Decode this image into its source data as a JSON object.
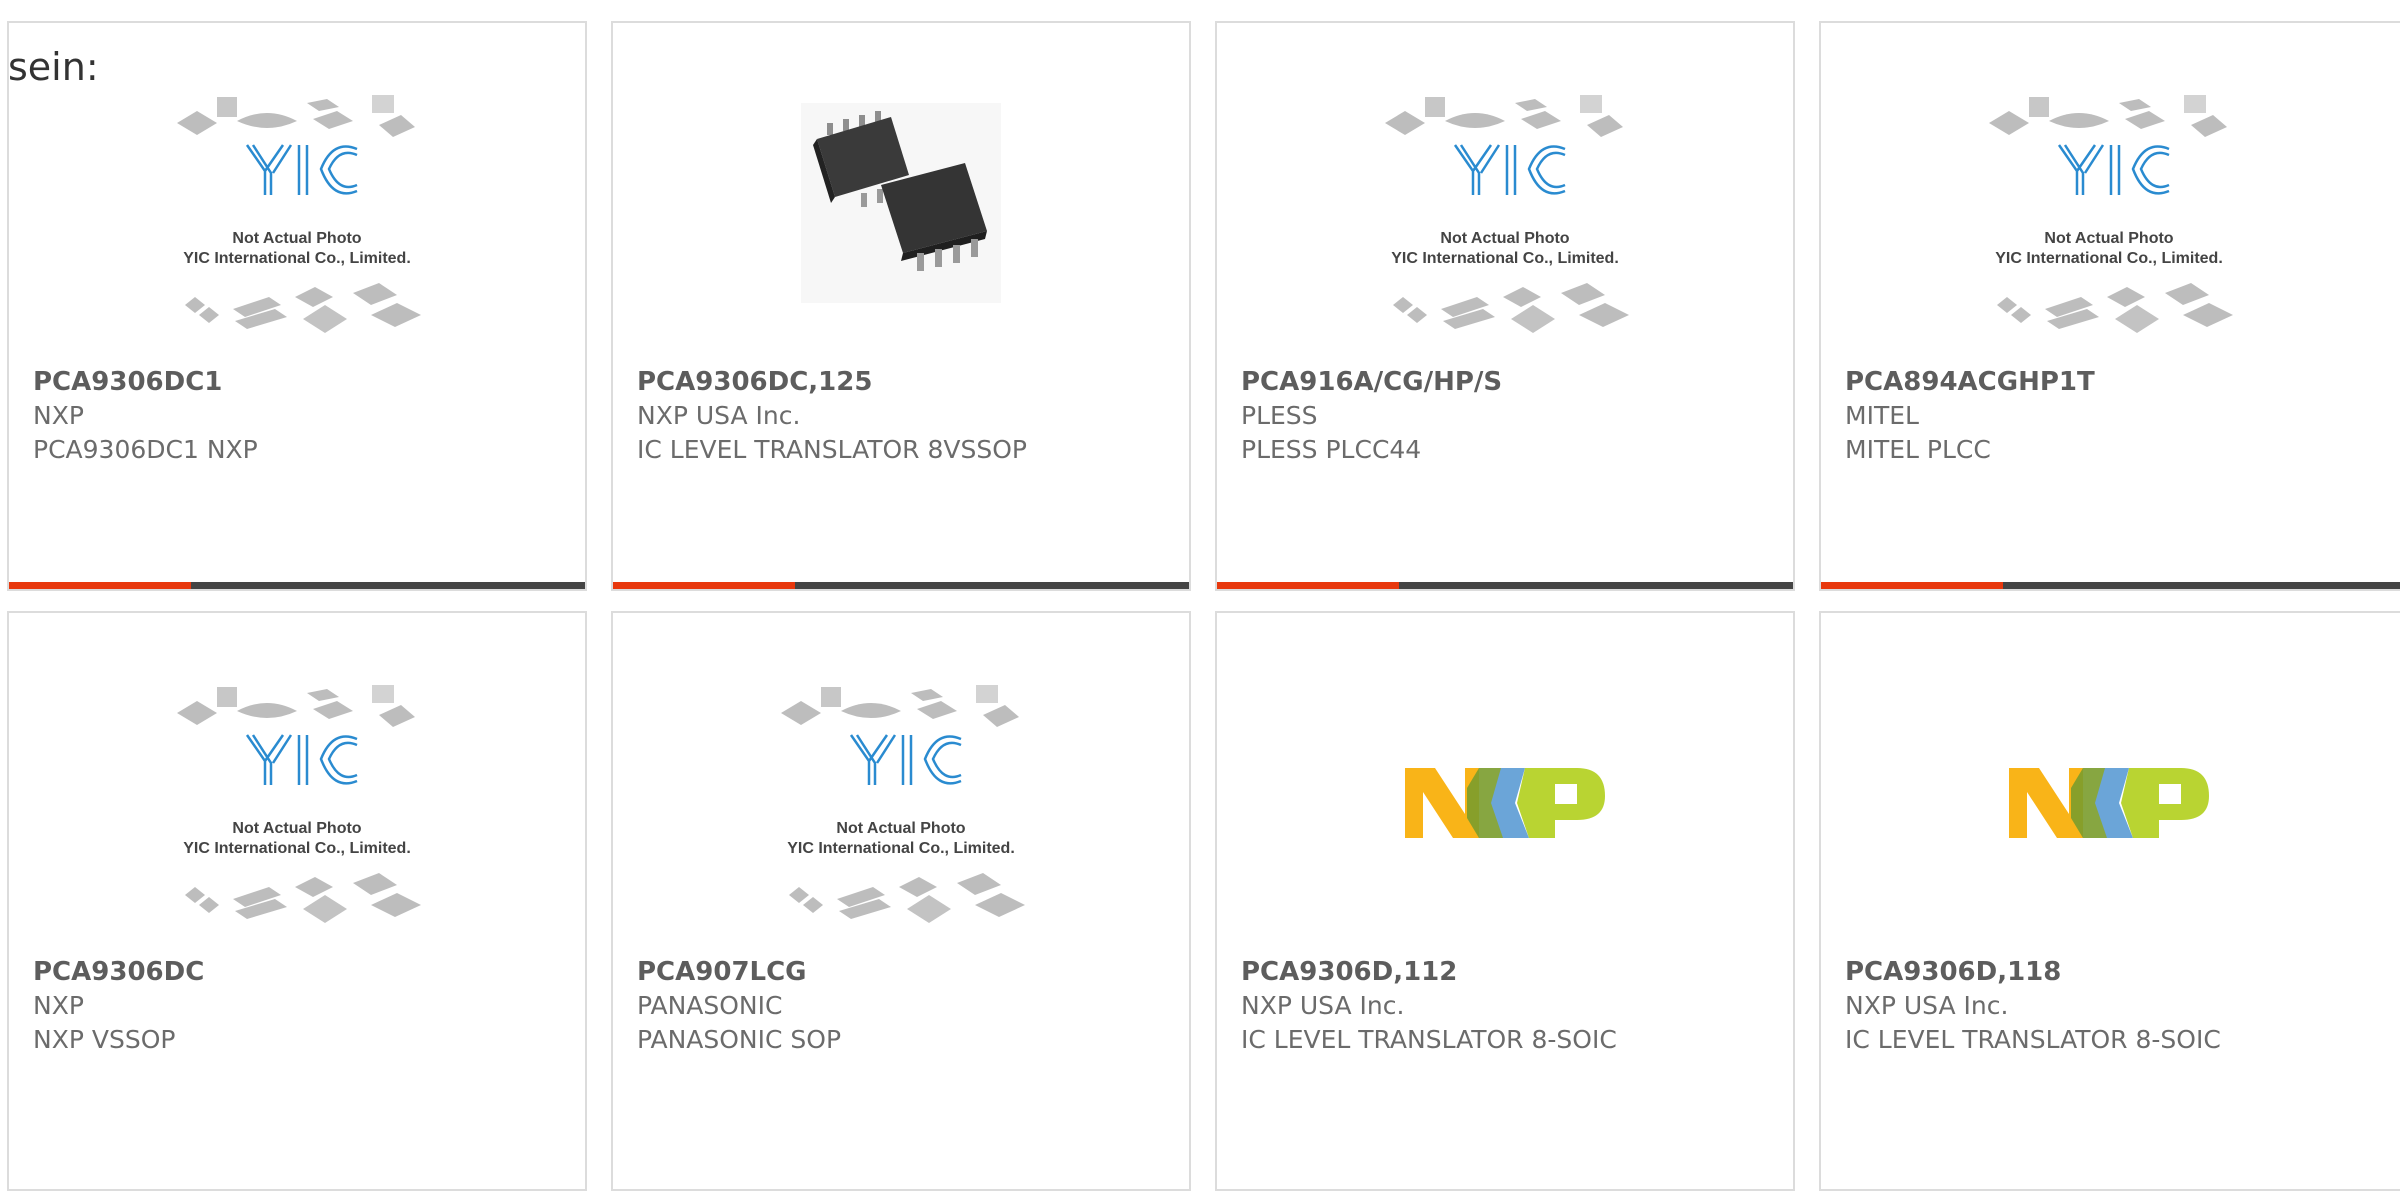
{
  "intro_text": "sein:",
  "placeholder": {
    "line1": "Not Actual Photo",
    "line2": "YIC International Co., Limited.",
    "logo": "YIC"
  },
  "colors": {
    "accent": "#e8380d",
    "bar": "#444444",
    "yic_logo": "#2a8bd0"
  },
  "products": [
    {
      "part": "PCA9306DC1",
      "manufacturer": "NXP",
      "description": "PCA9306DC1 NXP",
      "image": "yic-placeholder"
    },
    {
      "part": "PCA9306DC,125",
      "manufacturer": "NXP USA Inc.",
      "description": "IC LEVEL TRANSLATOR 8VSSOP",
      "image": "vssop-chip-photo"
    },
    {
      "part": "PCA916A/CG/HP/S",
      "manufacturer": "PLESS",
      "description": "PLESS PLCC44",
      "image": "yic-placeholder"
    },
    {
      "part": "PCA894ACGHP1T",
      "manufacturer": "MITEL",
      "description": "MITEL PLCC",
      "image": "yic-placeholder"
    },
    {
      "part": "PCA9306DC",
      "manufacturer": "NXP",
      "description": "NXP VSSOP",
      "image": "yic-placeholder"
    },
    {
      "part": "PCA907LCG",
      "manufacturer": "PANASONIC",
      "description": "PANASONIC SOP",
      "image": "yic-placeholder"
    },
    {
      "part": "PCA9306D,112",
      "manufacturer": "NXP USA Inc.",
      "description": "IC LEVEL TRANSLATOR 8-SOIC",
      "image": "nxp-logo"
    },
    {
      "part": "PCA9306D,118",
      "manufacturer": "NXP USA Inc.",
      "description": "IC LEVEL TRANSLATOR 8-SOIC",
      "image": "nxp-logo"
    }
  ]
}
